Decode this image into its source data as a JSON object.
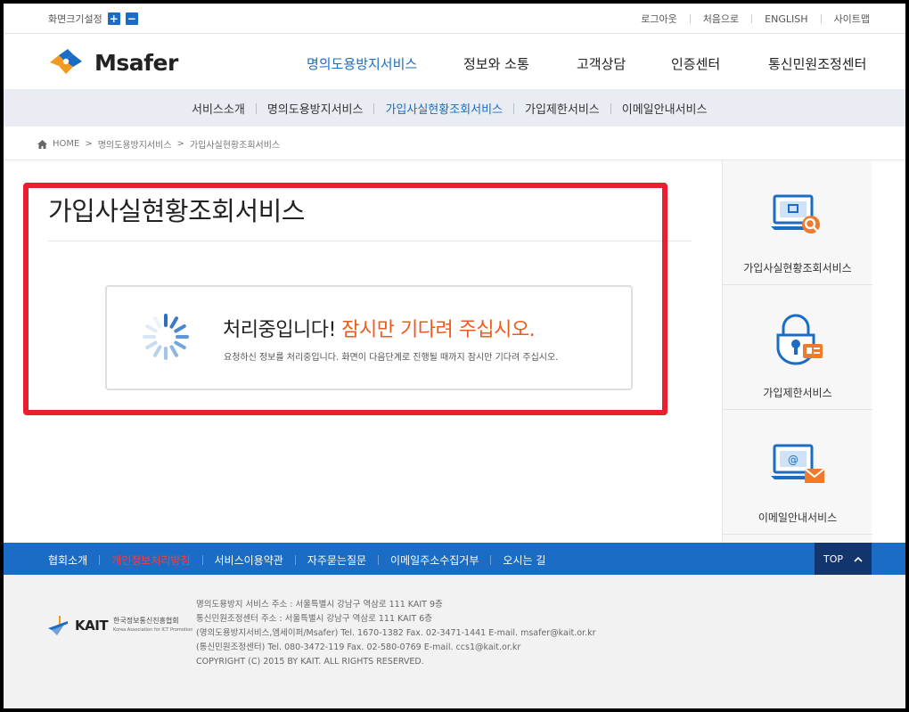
{
  "util": {
    "font_size_label": "화면크기설정",
    "zoom_in": "+",
    "zoom_out": "−",
    "links": [
      "로그아웃",
      "처음으로",
      "ENGLISH",
      "사이트맵"
    ]
  },
  "header": {
    "logo_text": "Msafer",
    "gnb": [
      {
        "label": "명의도용방지서비스",
        "active": true
      },
      {
        "label": "정보와 소통",
        "active": false
      },
      {
        "label": "고객상담",
        "active": false
      },
      {
        "label": "인증센터",
        "active": false
      },
      {
        "label": "통신민원조정센터",
        "active": false
      }
    ]
  },
  "subnav": [
    {
      "label": "서비스소개",
      "active": false
    },
    {
      "label": "명의도용방지서비스",
      "active": false
    },
    {
      "label": "가입사실현황조회서비스",
      "active": true
    },
    {
      "label": "가입제한서비스",
      "active": false
    },
    {
      "label": "이메일안내서비스",
      "active": false
    }
  ],
  "breadcrumb": {
    "home_icon": "home-icon",
    "items": [
      "HOME",
      "명의도용방지서비스",
      "가입사실현황조회서비스"
    ]
  },
  "main": {
    "title": "가입사실현황조회서비스",
    "processing": {
      "title_prefix": "처리중입니다!",
      "title_highlight": "잠시만 기다려 주십시오.",
      "description": "요청하신 정보를 처리중입니다. 화면이 다음단계로 진행될 때까지 잠시만 기다려 주십시오."
    }
  },
  "sidebar": [
    {
      "label": "가입사실현황조회서비스",
      "icon": "monitor-search-icon"
    },
    {
      "label": "가입제한서비스",
      "icon": "lock-id-icon"
    },
    {
      "label": "이메일안내서비스",
      "icon": "monitor-mail-icon"
    }
  ],
  "footer_nav": {
    "items": [
      {
        "label": "협회소개",
        "highlight": false
      },
      {
        "label": "개인정보처리방침",
        "highlight": true
      },
      {
        "label": "서비스이용약관",
        "highlight": false
      },
      {
        "label": "자주묻는질문",
        "highlight": false
      },
      {
        "label": "이메일주소수집거부",
        "highlight": false
      },
      {
        "label": "오시는 길",
        "highlight": false
      }
    ],
    "top_label": "TOP",
    "top_icon": "chevron-up-icon"
  },
  "footer": {
    "kait_name": "KAIT",
    "kait_korean": "한국정보통신진흥협회",
    "kait_english": "Korea Association for ICT Promotion",
    "info_lines": [
      "명의도용방지 서비스 주소 : 서울특별시 강남구 역삼로 111 KAIT 9층",
      "통신민원조정센터 주소 : 서울특별시 강남구 역삼로 111 KAIT 6층",
      "(명의도용방지서비스,엠세이퍼/Msafer) Tel. 1670-1382 Fax. 02-3471-1441 E-mail. msafer@kait.or.kr",
      "(통신민원조정센터) Tel. 080-3472-119 Fax. 02-580-0769 E-mail. ccs1@kait.or.kr",
      "COPYRIGHT (C) 2015 BY KAIT. ALL RIGHTS RESERVED."
    ]
  },
  "colors": {
    "brand_blue": "#1a6cc4",
    "highlight_orange": "#ee5a1d",
    "annotation_red": "#e8202e",
    "footer_nav_bg": "#1a6cc4"
  }
}
